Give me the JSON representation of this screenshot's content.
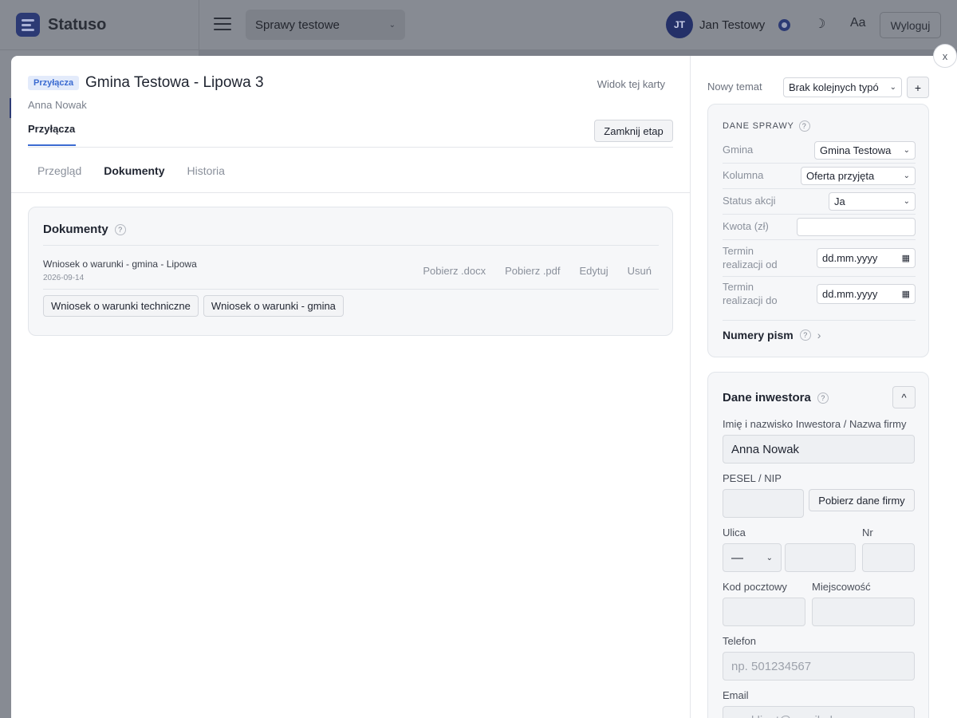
{
  "app": {
    "logo_text": "Statuso",
    "case_selector": "Sprawy testowe",
    "user_initials": "JT",
    "user_name": "Jan Testowy",
    "font_size_label": "Aa",
    "logout_label": "Wyloguj"
  },
  "modal": {
    "close_label": "x",
    "badge": "Przyłącza",
    "title": "Gmina Testowa - Lipowa 3",
    "subtitle": "Anna Nowak",
    "view_link": "Widok tej karty",
    "stage_tab": "Przyłącza",
    "close_stage_label": "Zamknij etap",
    "subtabs": [
      {
        "label": "Przegląd",
        "active": false
      },
      {
        "label": "Dokumenty",
        "active": true
      },
      {
        "label": "Historia",
        "active": false
      }
    ],
    "documents": {
      "title": "Dokumenty",
      "help": "?",
      "items": [
        {
          "name": "Wniosek o warunki - gmina - Lipowa",
          "date": "2026-09-14",
          "actions": [
            "Pobierz .docx",
            "Pobierz .pdf",
            "Edytuj",
            "Usuń"
          ]
        }
      ],
      "templates": [
        "Wniosek o warunki techniczne",
        "Wniosek o warunki - gmina"
      ]
    }
  },
  "sidebar": {
    "new_topic_label": "Nowy temat",
    "new_topic_select": "Brak kolejnych typó",
    "plus_label": "+",
    "case_data": {
      "caption": "DANE SPRAWY",
      "help": "?",
      "fields": [
        {
          "label": "Gmina",
          "value": "Gmina Testowa"
        },
        {
          "label": "Kolumna",
          "value": "Oferta przyjęta"
        },
        {
          "label": "Status akcji",
          "value": "Ja"
        },
        {
          "label": "Kwota (zł)",
          "value": ""
        },
        {
          "label": "Termin realizacji od",
          "value": "dd.mm.yyyy"
        },
        {
          "label": "Termin realizacji do",
          "value": "dd.mm.yyyy"
        }
      ],
      "numbers_label": "Numery pism"
    },
    "investor": {
      "title": "Dane inwestora",
      "help": "?",
      "collapse_label": "^",
      "name_label": "Imię i nazwisko Inwestora / Nazwa firmy",
      "name_value": "Anna Nowak",
      "pesel_label": "PESEL / NIP",
      "pesel_value": "",
      "fetch_label": "Pobierz dane firmy",
      "street_label": "Ulica",
      "street_prefix": "—",
      "nr_label": "Nr",
      "postal_label": "Kod pocztowy",
      "city_label": "Miejscowość",
      "phone_label": "Telefon",
      "phone_placeholder": "np. 501234567",
      "email_label": "Email",
      "email_placeholder": "np. klient@email.pl"
    }
  }
}
